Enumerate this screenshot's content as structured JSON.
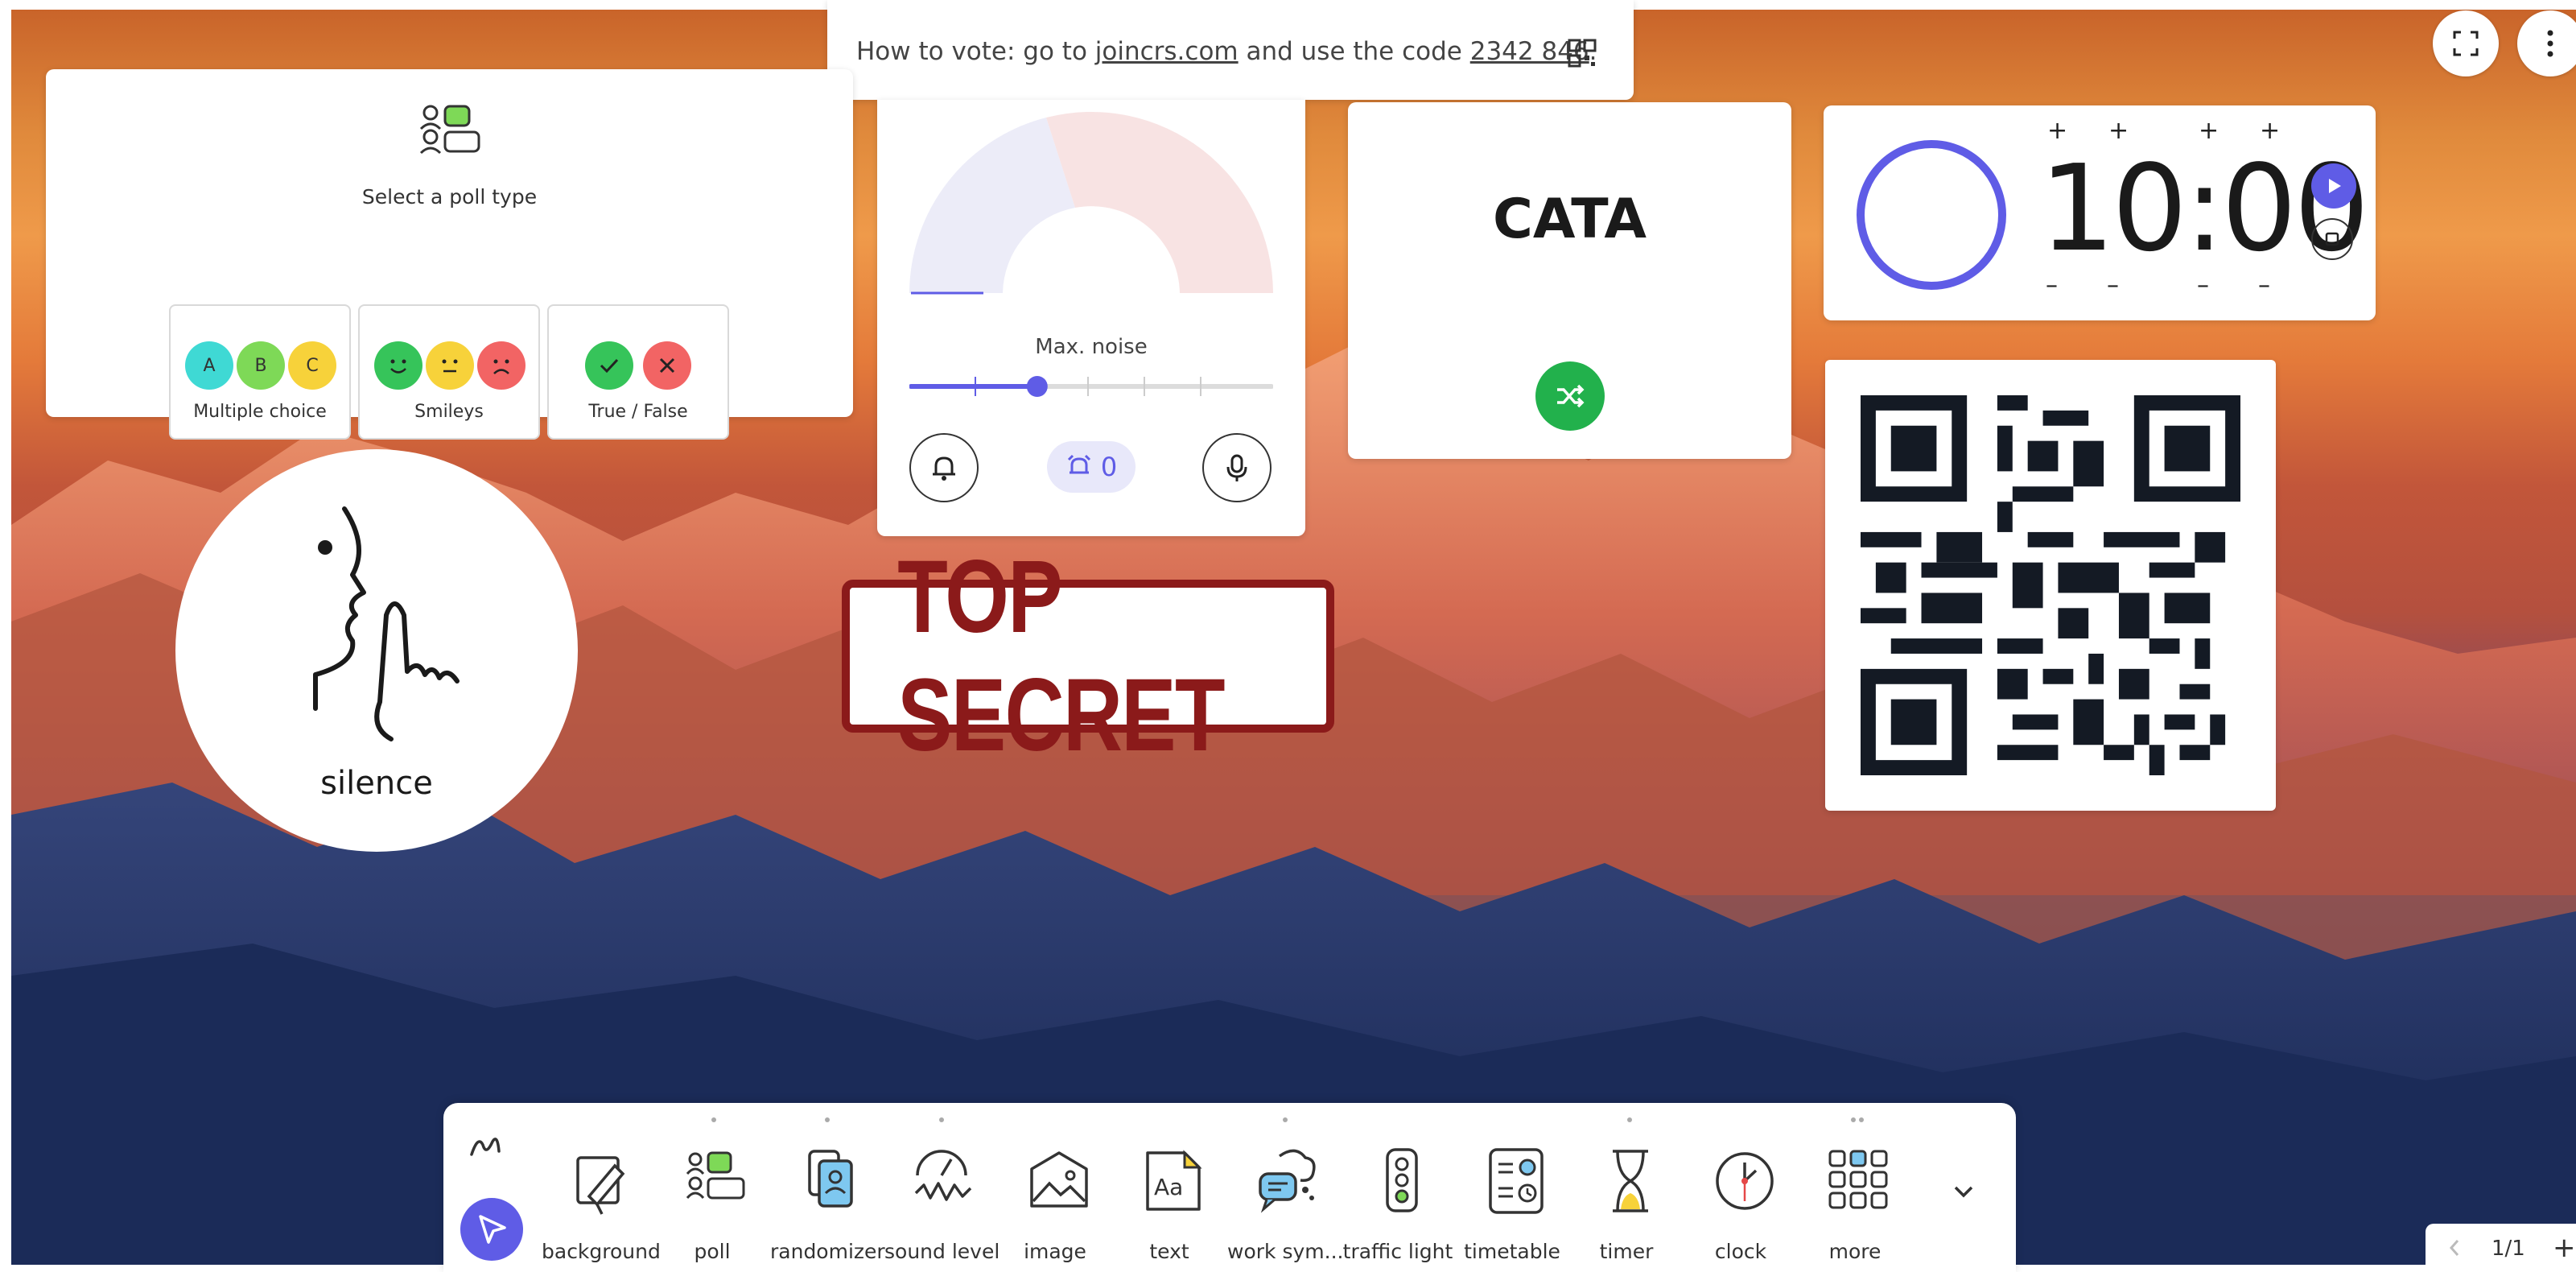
{
  "vote_banner": {
    "prefix": "How to vote: go to",
    "site": "joincrs.com",
    "middle": "and use the code",
    "code": "2342 846",
    "suffix": "."
  },
  "poll": {
    "title": "Select a poll type",
    "options": [
      {
        "label": "Multiple choice",
        "letters": [
          "A",
          "B",
          "C"
        ]
      },
      {
        "label": "Smileys"
      },
      {
        "label": "True / False"
      }
    ]
  },
  "sound": {
    "max_label": "Max. noise",
    "alarm_count": "0",
    "slider_level": 0.35
  },
  "randomizer": {
    "text": "CATA"
  },
  "timer": {
    "time": "10:00",
    "plus": "+",
    "minus": "–"
  },
  "silence": {
    "label": "silence"
  },
  "stamp": {
    "text": "TOP SECRET"
  },
  "toolbar": {
    "items": [
      {
        "label": "background",
        "icon": "background-icon"
      },
      {
        "label": "poll",
        "icon": "poll-icon"
      },
      {
        "label": "randomizer",
        "icon": "randomizer-icon"
      },
      {
        "label": "sound level",
        "icon": "sound-level-icon"
      },
      {
        "label": "image",
        "icon": "image-icon"
      },
      {
        "label": "text",
        "icon": "text-icon"
      },
      {
        "label": "work sym...",
        "icon": "work-symbols-icon"
      },
      {
        "label": "traffic light",
        "icon": "traffic-light-icon"
      },
      {
        "label": "timetable",
        "icon": "timetable-icon"
      },
      {
        "label": "timer",
        "icon": "hourglass-icon"
      },
      {
        "label": "clock",
        "icon": "clock-icon"
      },
      {
        "label": "more",
        "icon": "grid-icon"
      }
    ]
  },
  "pager": {
    "text": "1/1",
    "add": "+"
  },
  "colors": {
    "accent": "#5f5ce6",
    "green": "#22b14c",
    "poll_green": "#7ed957",
    "stamp_red": "#8b1a1a"
  }
}
